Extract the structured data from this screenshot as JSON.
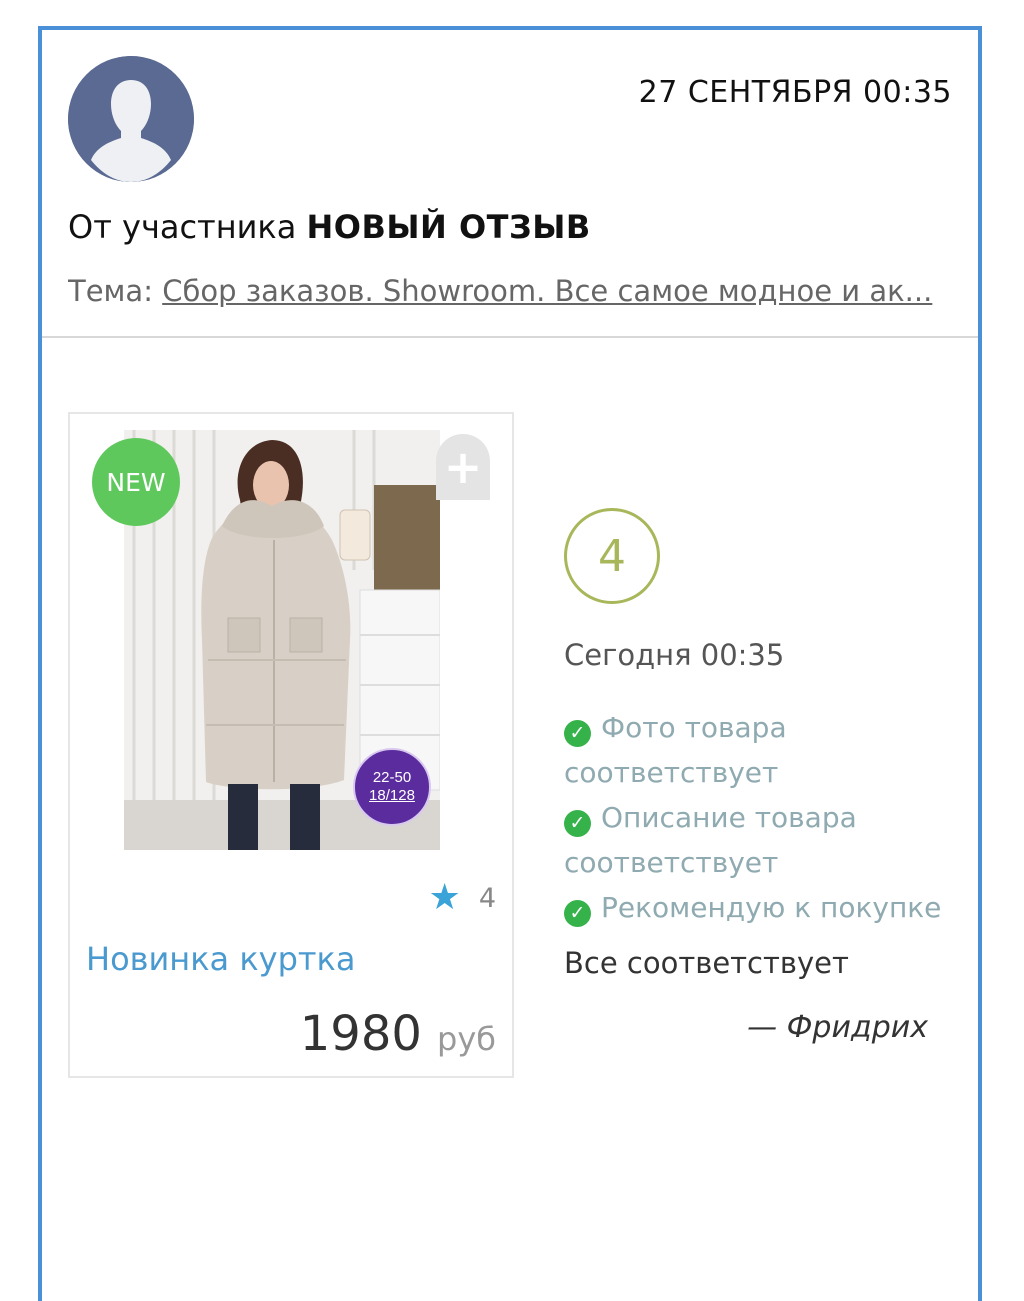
{
  "header": {
    "date": "27 СЕНТЯБРЯ 00:35",
    "from_prefix": "От участника",
    "from_name": "НОВЫЙ ОТЗЫВ",
    "topic_label": "Тема:",
    "topic_link": "Сбор заказов. Showroom. Все самое модное и ак..."
  },
  "product": {
    "badge": "NEW",
    "plus": "+",
    "size_line1": "22-50",
    "size_line2": "18/128",
    "rating": "4",
    "title": "Новинка куртка",
    "price": "1980",
    "currency": "руб"
  },
  "review": {
    "score": "4",
    "time": "Сегодня 00:35",
    "checks": [
      "Фото товара соответствует",
      "Описание товара соответствует",
      "Рекомендую к покупке"
    ],
    "text": "Все соответствует",
    "author": "— Фридрих"
  },
  "colors": {
    "frame": "#4a90d9",
    "new_badge": "#5fc85c",
    "score": "#a7b75a",
    "check": "#35b24a",
    "link": "#4a9ad0",
    "star": "#3aa3d8"
  },
  "icons": [
    "user-avatar-icon",
    "plus-icon",
    "star-icon",
    "check-circle-icon"
  ]
}
